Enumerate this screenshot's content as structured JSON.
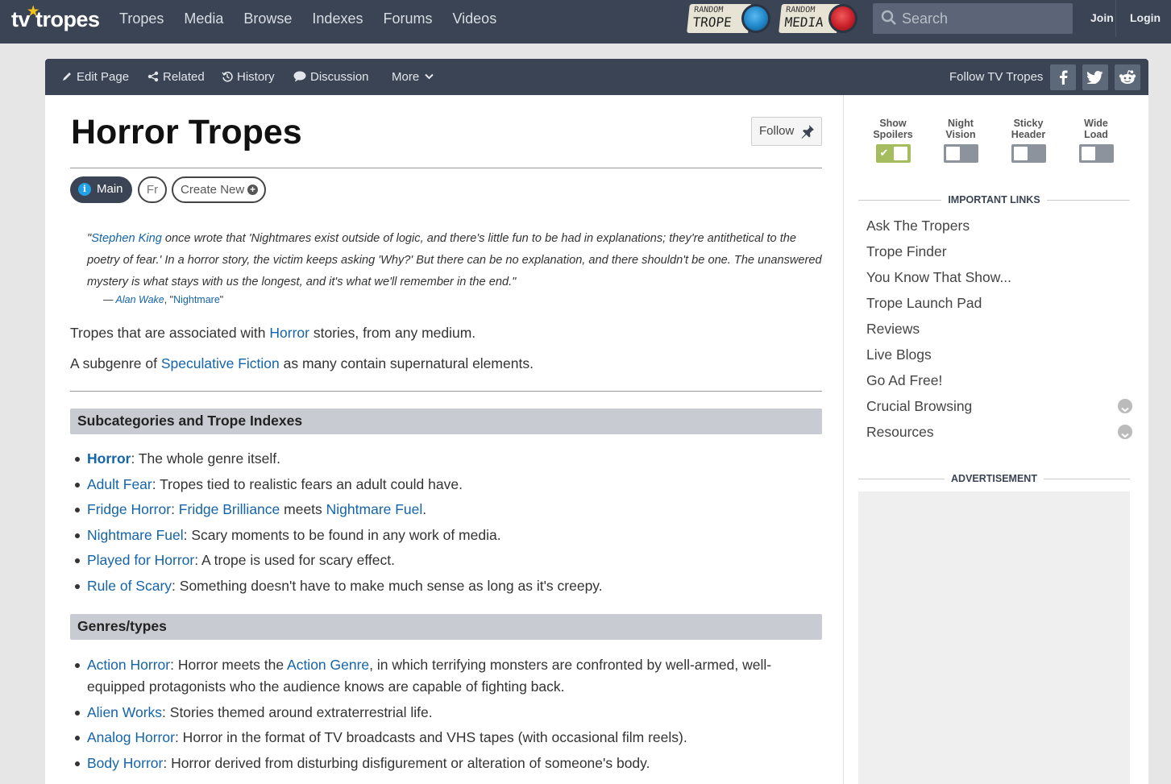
{
  "topnav": {
    "logo": "tv tropes",
    "links": [
      "Tropes",
      "Media",
      "Browse",
      "Indexes",
      "Forums",
      "Videos"
    ],
    "random_trope": {
      "small": "RANDOM",
      "big": "TROPE"
    },
    "random_media": {
      "small": "RANDOM",
      "big": "MEDIA"
    },
    "search_placeholder": "Search",
    "join": "Join",
    "login": "Login"
  },
  "toolbar": {
    "edit": "Edit Page",
    "related": "Related",
    "history": "History",
    "discussion": "Discussion",
    "more": "More",
    "follow_tv": "Follow TV Tropes"
  },
  "page": {
    "title": "Horror Tropes",
    "follow": "Follow",
    "tabs": {
      "main": "Main",
      "fr": "Fr",
      "create": "Create New"
    },
    "quote": {
      "open": "\"",
      "link": "Stephen King",
      "text": " once wrote that 'Nightmares exist outside of logic, and there's little fun to be had in explanations; they're antithetical to the poetry of fear.' In a horror story, the victim keeps asking 'Why?' But there can be no explanation, and there shouldn't be one. The unanswered mystery is what stays with us the longest, and it's what we'll remember in the end.\"",
      "attrib_dash": "— ",
      "attrib_work": "Alan Wake",
      "attrib_sep": ", \"",
      "attrib_title": "Nightmare",
      "attrib_end": "\""
    },
    "para1": {
      "pre": "Tropes that are associated with ",
      "link": "Horror",
      "post": " stories, from any medium."
    },
    "para2": {
      "pre": "A subgenre of ",
      "link": "Speculative Fiction",
      "post": " as many contain supernatural elements."
    },
    "section1": "Subcategories and Trope Indexes",
    "section2": "Genres/types"
  },
  "sub_items": [
    {
      "link": "Horror",
      "text": ": The whole genre itself."
    },
    {
      "link": "Adult Fear",
      "text": ": Tropes tied to realistic fears an adult could have."
    },
    {
      "link": "Fridge Horror",
      "text": ": ",
      "link2": "Fridge Brilliance",
      "mid": " meets ",
      "link3": "Nightmare Fuel",
      "end": "."
    },
    {
      "link": "Nightmare Fuel",
      "text": ": Scary moments to be found in any work of media."
    },
    {
      "link": "Played for Horror",
      "text": ": A trope is used for scary effect."
    },
    {
      "link": "Rule of Scary",
      "text": ": Something doesn't have to make much sense as long as it's creepy."
    }
  ],
  "genre_items": [
    {
      "link": "Action Horror",
      "text": ": Horror meets the ",
      "link2": "Action Genre",
      "end": ", in which terrifying monsters are confronted by well-armed, well-equipped protagonists who the audience knows are capable of fighting back."
    },
    {
      "link": "Alien Works",
      "text": ": Stories themed around extraterrestrial life."
    },
    {
      "link": "Analog Horror",
      "text": ": Horror in the format of TV broadcasts and VHS tapes (with occasional film reels)."
    },
    {
      "link": "Body Horror",
      "text": ": Horror derived from disturbing disfigurement or alteration of someone's body."
    }
  ],
  "sidebar": {
    "toggles": [
      {
        "l1": "Show",
        "l2": "Spoilers",
        "on": true
      },
      {
        "l1": "Night",
        "l2": "Vision",
        "on": false
      },
      {
        "l1": "Sticky",
        "l2": "Header",
        "on": false
      },
      {
        "l1": "Wide",
        "l2": "Load",
        "on": false
      }
    ],
    "important_links": "IMPORTANT LINKS",
    "links": [
      "Ask The Tropers",
      "Trope Finder",
      "You Know That Show...",
      "Trope Launch Pad",
      "Reviews",
      "Live Blogs",
      "Go Ad Free!",
      "Crucial Browsing",
      "Resources"
    ],
    "advertisement": "ADVERTISEMENT"
  },
  "colors": {
    "nav": "#3a4454",
    "link": "#1464a8",
    "section_bg": "#c8ccd2",
    "toggle_on": "#a5bd5f"
  }
}
